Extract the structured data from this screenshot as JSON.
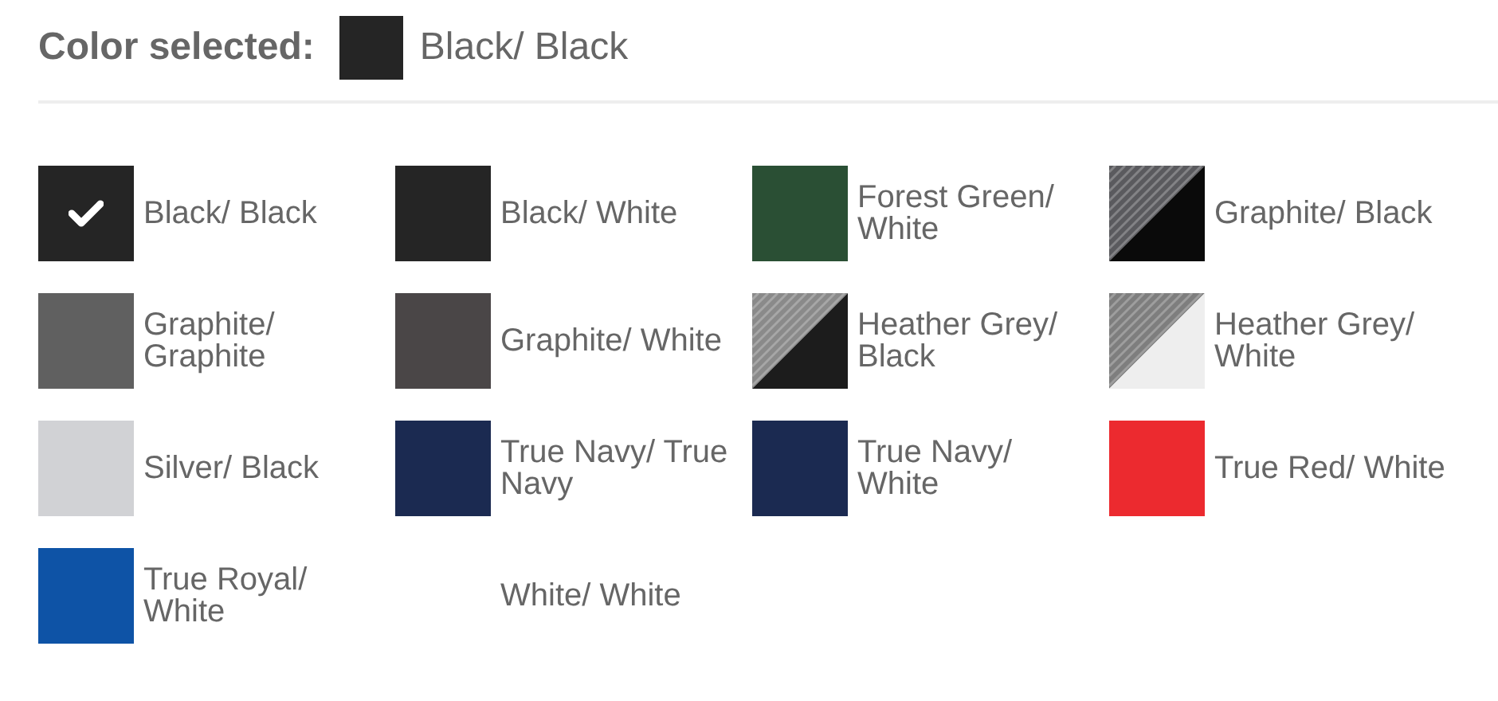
{
  "header": {
    "label": "Color selected:",
    "color": "#252525",
    "value": "Black/ Black"
  },
  "colors": [
    {
      "name": "Black/ Black",
      "kind": "solid",
      "color": "#252525",
      "selected": true
    },
    {
      "name": "Black/ White",
      "kind": "solid",
      "color": "#252525",
      "selected": false
    },
    {
      "name": "Forest Green/ White",
      "kind": "solid",
      "color": "#2a4f34",
      "selected": false
    },
    {
      "name": "Graphite/ Black",
      "kind": "split",
      "color": "#5a5a5e",
      "lower": {
        "color": "#0a0a0a"
      },
      "selected": false
    },
    {
      "name": "Graphite/ Graphite",
      "kind": "solid",
      "color": "#606060",
      "selected": false
    },
    {
      "name": "Graphite/ White",
      "kind": "solid",
      "color": "#4a4647",
      "selected": false
    },
    {
      "name": "Heather Grey/ Black",
      "kind": "split",
      "color": "#8a8a8a",
      "lower": {
        "color": "#1c1c1c"
      },
      "selected": false
    },
    {
      "name": "Heather Grey/ White",
      "kind": "split",
      "color": "#7e7e7e",
      "lower": {
        "color": "#eeeeee"
      },
      "selected": false
    },
    {
      "name": "Silver/ Black",
      "kind": "solid",
      "color": "#d1d2d5",
      "selected": false
    },
    {
      "name": "True Navy/ True Navy",
      "kind": "solid",
      "color": "#1b2a51",
      "selected": false
    },
    {
      "name": "True Navy/ White",
      "kind": "solid",
      "color": "#1b2a51",
      "selected": false
    },
    {
      "name": "True Red/ White",
      "kind": "solid",
      "color": "#ec2a2f",
      "selected": false
    },
    {
      "name": "True Royal/ White",
      "kind": "solid",
      "color": "#0e53a6",
      "selected": false
    },
    {
      "name": "White/ White",
      "kind": "solid",
      "color": "#ffffff",
      "selected": false
    }
  ]
}
